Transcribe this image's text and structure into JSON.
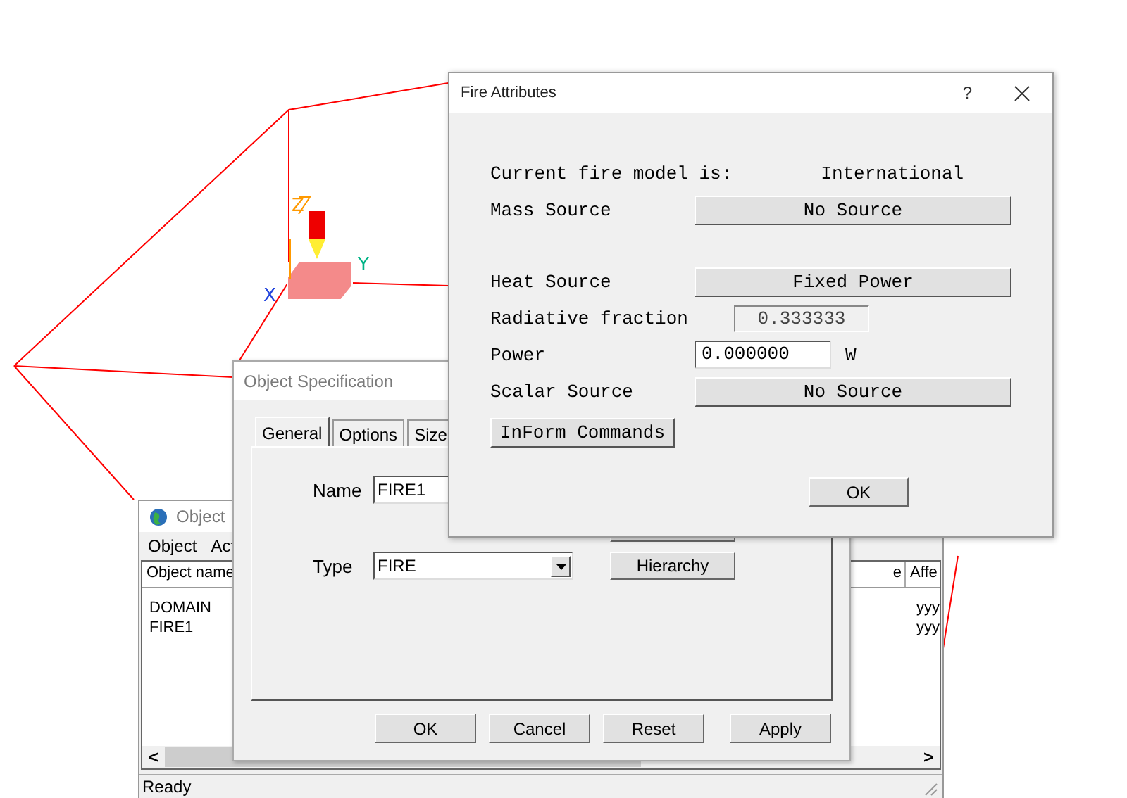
{
  "viewport": {
    "axis_labels": [
      {
        "label": "Z",
        "color": "#ff9900"
      },
      {
        "label": "Y",
        "color": "#00b386"
      },
      {
        "label": "X",
        "color": "#2244dd"
      }
    ]
  },
  "object_manager": {
    "title": "Object",
    "menu": [
      "Object",
      "Act"
    ],
    "columns": [
      "Object name",
      "e",
      "Affe"
    ],
    "rows": [
      {
        "name": "DOMAIN",
        "affects": "yyy"
      },
      {
        "name": "FIRE1",
        "affects": "yyy"
      }
    ],
    "scroll_left": "<",
    "scroll_right": ">",
    "status_bar": "Ready"
  },
  "object_specification": {
    "title": "Object Specification",
    "tabs": [
      {
        "label": "General",
        "selected": true
      },
      {
        "label": "Options",
        "selected": false
      },
      {
        "label": "Size",
        "selected": false
      }
    ],
    "name_label": "Name",
    "name_value": "FIRE1",
    "type_label": "Type",
    "type_value": "FIRE",
    "hierarchy_button": "Hierarchy",
    "buttons": [
      "OK",
      "Cancel",
      "Reset",
      "Apply"
    ]
  },
  "fire_attributes": {
    "title": "Fire Attributes",
    "help": "?",
    "model_label": "Current fire model is:",
    "model_value": "International",
    "rows": [
      {
        "kind": "button",
        "label": "Mass Source",
        "value": "No Source"
      },
      {
        "kind": "button",
        "label": "Heat Source",
        "value": "Fixed Power"
      },
      {
        "kind": "readonly",
        "label": "Radiative fraction",
        "value": "0.333333"
      },
      {
        "kind": "input",
        "label": "Power",
        "value": "0.000000",
        "unit": "W"
      },
      {
        "kind": "button",
        "label": "Scalar Source",
        "value": "No Source"
      }
    ],
    "inform_button": "InForm Commands",
    "ok_button": "OK"
  }
}
